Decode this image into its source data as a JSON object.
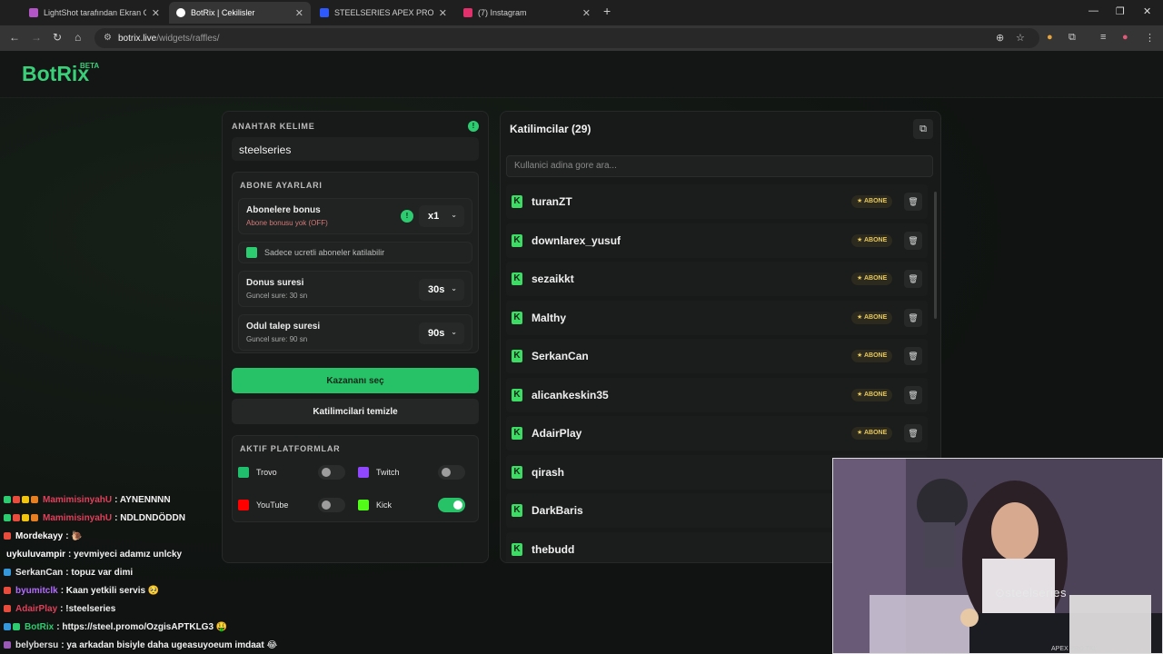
{
  "browser": {
    "tabs": [
      {
        "title": "LightShot tarafından Ekran Görü",
        "color": "#b355c7"
      },
      {
        "title": "BotRix | Cekilisler",
        "color": "#ffffff"
      },
      {
        "title": "STEELSERIES APEX PRO TKL GE",
        "color": "#2d59ff"
      },
      {
        "title": "(7) Instagram",
        "color": "#e1306c"
      }
    ],
    "new_tab": "+",
    "url_host": "botrix.live",
    "url_path": "/widgets/raffles/"
  },
  "app": {
    "logo": "BotRix",
    "logo_badge": "BETA"
  },
  "settings": {
    "keyword_label": "ANAHTAR KELIME",
    "keyword_info": "!",
    "keyword_value": "steelseries",
    "sub_label": "ABONE AYARLARI",
    "sub_bonus_title": "Abonelere bonus",
    "sub_bonus_sub": "Abone bonusu yok (OFF)",
    "sub_bonus_info": "!",
    "sub_bonus_value": "x1",
    "paid_only_label": "Sadece ucretli aboneler katilabilir",
    "bonus_time_title": "Donus suresi",
    "bonus_time_sub": "Guncel sure: 30 sn",
    "bonus_time_value": "30s",
    "claim_time_title": "Odul talep suresi",
    "claim_time_sub": "Guncel sure: 90 sn",
    "claim_time_value": "90s",
    "pick_winner": "Kazananı seç",
    "clear_participants": "Katilimcilari temizle",
    "platforms_label": "AKTIF PLATFORMLAR",
    "platforms": [
      {
        "name": "Trovo",
        "on": false,
        "color": "#1fbf6e"
      },
      {
        "name": "Twitch",
        "on": false,
        "color": "#9146ff"
      },
      {
        "name": "YouTube",
        "on": false,
        "color": "#ff0000"
      },
      {
        "name": "Kick",
        "on": true,
        "color": "#53fc18"
      }
    ]
  },
  "participants": {
    "title": "Katilimcilar (29)",
    "search_placeholder": "Kullanici adina gore ara...",
    "badge_label": "★ ABONE",
    "list": [
      {
        "name": "turanZT",
        "sub": true
      },
      {
        "name": "downlarex_yusuf",
        "sub": true
      },
      {
        "name": "sezaikkt",
        "sub": true
      },
      {
        "name": "Malthy",
        "sub": true
      },
      {
        "name": "SerkanCan",
        "sub": true
      },
      {
        "name": "alicankeskin35",
        "sub": true
      },
      {
        "name": "AdairPlay",
        "sub": true
      },
      {
        "name": "qirash",
        "sub": false
      },
      {
        "name": "DarkBaris",
        "sub": false
      },
      {
        "name": "thebudd",
        "sub": false
      }
    ]
  },
  "chat": [
    {
      "name": "MamimisinyahU",
      "color": "#e0405a",
      "msg": ": AYNENNNN",
      "badges": [
        "#2ecc71",
        "#e84c3d",
        "#f1c40f",
        "#e67e22"
      ]
    },
    {
      "name": "MamimisinyahU",
      "color": "#e0405a",
      "msg": ": NDLDNDÖDDN",
      "badges": [
        "#2ecc71",
        "#e84c3d",
        "#f1c40f",
        "#e67e22"
      ]
    },
    {
      "name": "Mordekayy",
      "color": "#ffffff",
      "msg": ": 🐌",
      "badges": [
        "#e84c3d"
      ]
    },
    {
      "name": "uykuluvampir",
      "color": "#ffffff",
      "msg": ": yevmiyeci adamız unlcky",
      "badges": []
    },
    {
      "name": "SerkanCan",
      "color": "#e8e8e8",
      "msg": ": topuz var dimi",
      "badges": [
        "#3498db"
      ]
    },
    {
      "name": "byumitclk",
      "color": "#b36cff",
      "msg": ": Kaan yetkili servis 🥺",
      "badges": [
        "#e84c3d"
      ]
    },
    {
      "name": "AdairPlay",
      "color": "#e0405a",
      "msg": ": !steelseries",
      "badges": [
        "#e84c3d"
      ]
    },
    {
      "name": "BotRix",
      "color": "#2ecc71",
      "msg": ": https://steel.promo/OzgisAPTKLG3 🤑",
      "badges": [
        "#3498db",
        "#2ecc71"
      ]
    },
    {
      "name": "belybersu",
      "color": "#e0e0e0",
      "msg": ": ya arkadan bisiyle daha ugeasuyoeum imdaat 😂",
      "badges": [
        "#9b59b6"
      ]
    }
  ],
  "webcam": {
    "brand": "⊙steelseries",
    "product": "APEX PRO TKL"
  }
}
